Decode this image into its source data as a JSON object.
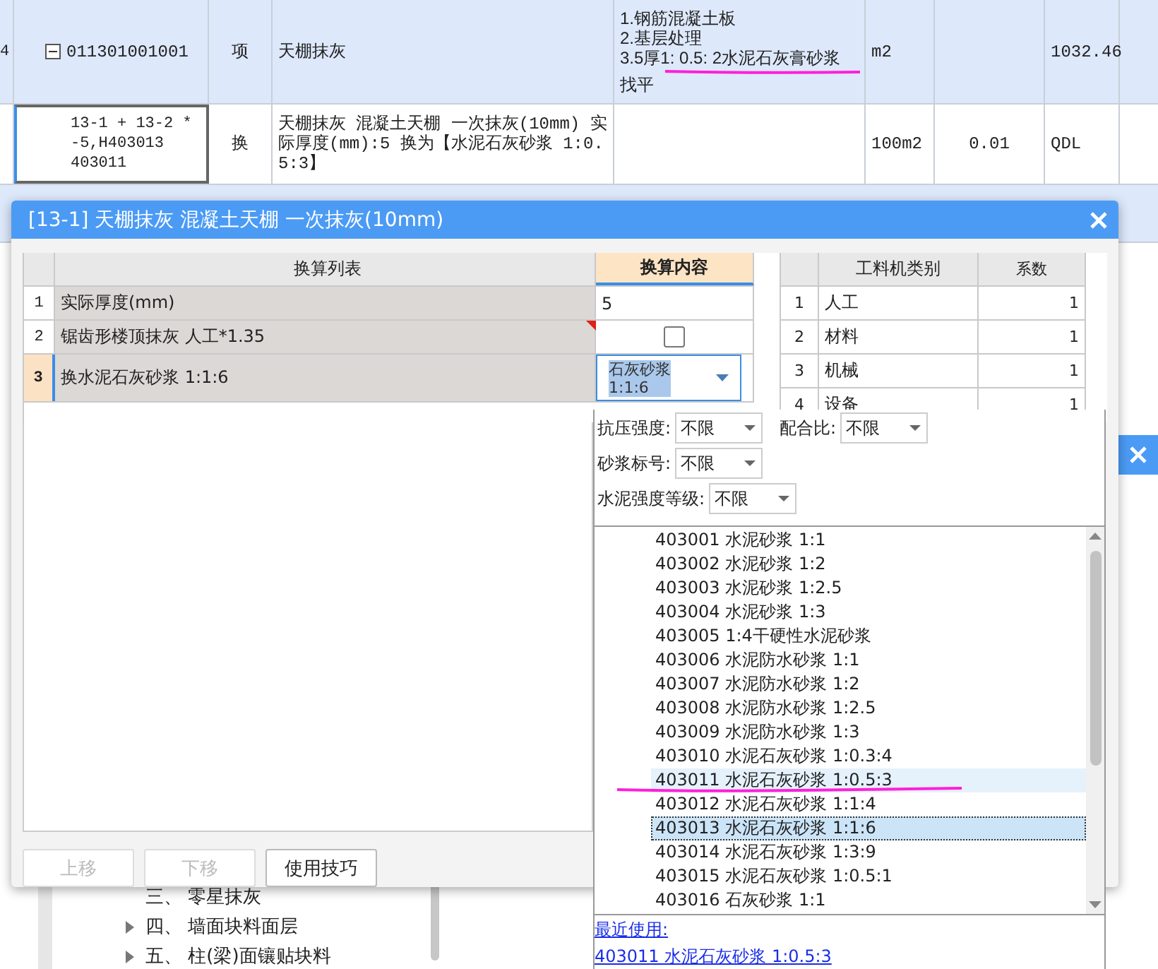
{
  "grid": {
    "rows": [
      {
        "number": "4",
        "code": "011301001001",
        "expanded": true,
        "type": "项",
        "name": "天棚抹灰",
        "feature": [
          "1.钢筋混凝土板",
          "2.基层处理",
          "3.5厚1: 0.5: 2水泥石灰膏砂浆",
          "找平"
        ],
        "unit": "m2",
        "column_7": "",
        "column_8": "1032.46",
        "selected": false
      },
      {
        "number": "",
        "code": "13-1 + 13-2 *\n-5,H403013\n403011",
        "type": "换",
        "name": "天棚抹灰 混凝土天棚 一次抹灰(10mm) 实际厚度(mm):5 换为【水泥石灰砂浆 1:0.5:3】",
        "feature": [],
        "unit": "100m2",
        "column_7": "0.01",
        "column_8": "QDL",
        "selected": true
      }
    ]
  },
  "tree": {
    "items": [
      {
        "label": "三、 零星抹灰",
        "has_children": false
      },
      {
        "label": "四、 墙面块料面层",
        "has_children": true
      },
      {
        "label": "五、 柱(梁)面镶贴块料",
        "has_children": true
      }
    ]
  },
  "dialog": {
    "title": "[13-1] 天棚抹灰 混凝土天棚 一次抹灰(10mm)",
    "conversion_table": {
      "columns": [
        "换算列表",
        "换算内容"
      ],
      "rows": [
        {
          "number": "1",
          "name": "实际厚度(mm)",
          "kind": "text",
          "value": "5",
          "selected": false
        },
        {
          "number": "2",
          "name": "锯齿形楼顶抹灰 人工*1.35",
          "kind": "checkbox",
          "checked": false,
          "selected": false
        },
        {
          "number": "3",
          "name": "换水泥石灰砂浆 1:1:6",
          "kind": "dropdown",
          "value": "石灰砂浆\n1:1:6",
          "selected": true
        }
      ]
    },
    "factor_table": {
      "columns": [
        "工料机类别",
        "系数"
      ],
      "rows": [
        {
          "number": "1",
          "category": "人工",
          "factor": "1"
        },
        {
          "number": "2",
          "category": "材料",
          "factor": "1"
        },
        {
          "number": "3",
          "category": "机械",
          "factor": "1"
        },
        {
          "number": "4",
          "category": "设备",
          "factor": "1"
        }
      ]
    },
    "buttons": [
      {
        "label": "上移",
        "disabled": true
      },
      {
        "label": "下移",
        "disabled": true
      },
      {
        "label": "使用技巧",
        "disabled": false
      }
    ]
  },
  "popup": {
    "filter_rows": [
      [
        {
          "label": "抗压强度:",
          "value": "不限"
        },
        {
          "label": "配合比:",
          "value": "不限"
        }
      ],
      [
        {
          "label": "砂浆标号:",
          "value": "不限"
        }
      ],
      [
        {
          "label": "水泥强度等级:",
          "value": "不限"
        }
      ]
    ],
    "items": [
      {
        "code": "403001",
        "name": "水泥砂浆 1:1",
        "selected": false,
        "hovered": false
      },
      {
        "code": "403002",
        "name": "水泥砂浆 1:2",
        "selected": false,
        "hovered": false
      },
      {
        "code": "403003",
        "name": "水泥砂浆 1:2.5",
        "selected": false,
        "hovered": false
      },
      {
        "code": "403004",
        "name": "水泥砂浆 1:3",
        "selected": false,
        "hovered": false
      },
      {
        "code": "403005",
        "name": "1:4干硬性水泥砂浆",
        "selected": false,
        "hovered": false
      },
      {
        "code": "403006",
        "name": "水泥防水砂浆 1:1",
        "selected": false,
        "hovered": false
      },
      {
        "code": "403007",
        "name": "水泥防水砂浆 1:2",
        "selected": false,
        "hovered": false
      },
      {
        "code": "403008",
        "name": "水泥防水砂浆 1:2.5",
        "selected": false,
        "hovered": false
      },
      {
        "code": "403009",
        "name": "水泥防水砂浆 1:3",
        "selected": false,
        "hovered": false
      },
      {
        "code": "403010",
        "name": "水泥石灰砂浆 1:0.3:4",
        "selected": false,
        "hovered": false
      },
      {
        "code": "403011",
        "name": "水泥石灰砂浆 1:0.5:3",
        "selected": false,
        "hovered": true
      },
      {
        "code": "403012",
        "name": "水泥石灰砂浆 1:1:4",
        "selected": false,
        "hovered": false
      },
      {
        "code": "403013",
        "name": "水泥石灰砂浆 1:1:6",
        "selected": true,
        "hovered": false
      },
      {
        "code": "403014",
        "name": "水泥石灰砂浆 1:3:9",
        "selected": false,
        "hovered": false
      },
      {
        "code": "403015",
        "name": "水泥石灰砂浆 1:0.5:1",
        "selected": false,
        "hovered": false
      },
      {
        "code": "403016",
        "name": "石灰砂浆 1:1",
        "selected": false,
        "hovered": false
      }
    ],
    "recent_label": "最近使用:",
    "recent_item": "403011 水泥石灰砂浆 1:0.5:3"
  }
}
